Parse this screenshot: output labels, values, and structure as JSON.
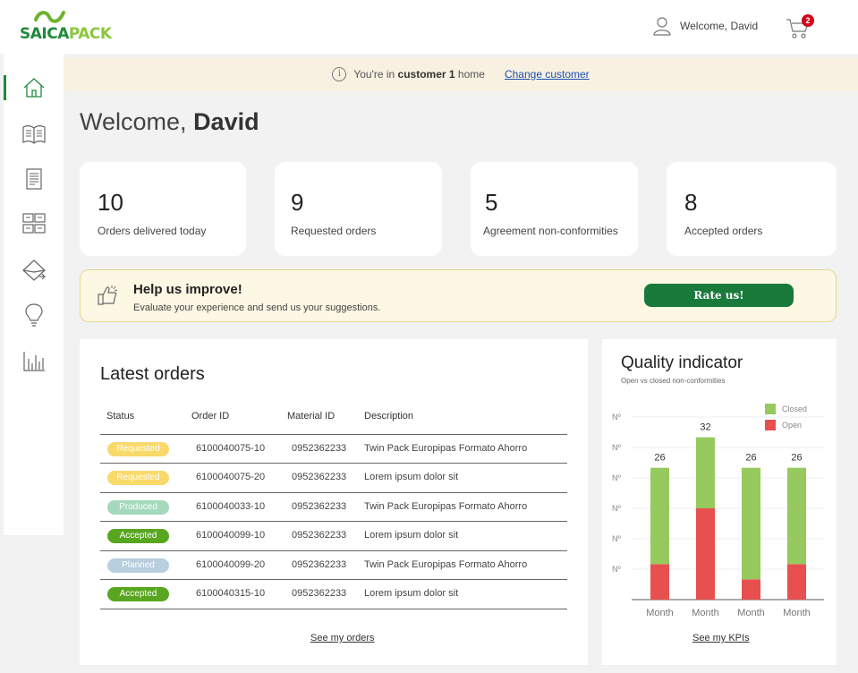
{
  "header": {
    "logo_text_a": "SAICA",
    "logo_text_b": "PACK",
    "welcome": "Welcome, David",
    "cart_count": "2"
  },
  "sidebar": {
    "items": [
      {
        "icon": "home-icon",
        "active": true
      },
      {
        "icon": "catalog-book-icon"
      },
      {
        "icon": "document-icon"
      },
      {
        "icon": "boxes-icon"
      },
      {
        "icon": "mail-icon"
      },
      {
        "icon": "lightbulb-icon"
      },
      {
        "icon": "bar-chart-icon"
      }
    ]
  },
  "banner": {
    "prefix": "You're in",
    "customer": "customer 1",
    "suffix": "home",
    "link": "Change customer"
  },
  "page": {
    "greeting": "Welcome,",
    "name": "David"
  },
  "kpis": [
    {
      "value": "10",
      "label": "Orders delivered today"
    },
    {
      "value": "9",
      "label": "Requested orders"
    },
    {
      "value": "5",
      "label": "Agreement non-conformities"
    },
    {
      "value": "8",
      "label": "Accepted orders"
    }
  ],
  "help": {
    "title": "Help us improve!",
    "subtitle": "Evaluate your experience and send us your suggestions.",
    "button": "Rate us!"
  },
  "orders": {
    "title": "Latest orders",
    "columns": [
      "Status",
      "Order ID",
      "Material ID",
      "Description"
    ],
    "rows": [
      {
        "status": "Requested",
        "order_id": "6100040075-10",
        "material_id": "0952362233",
        "description": "Twin Pack Europipas Formato Ahorro"
      },
      {
        "status": "Requested",
        "order_id": "6100040075-20",
        "material_id": "0952362233",
        "description": "Lorem ipsum dolor sit"
      },
      {
        "status": "Produced",
        "order_id": "6100040033-10",
        "material_id": "0952362233",
        "description": "Twin Pack Europipas Formato Ahorro"
      },
      {
        "status": "Accepted",
        "order_id": "6100040099-10",
        "material_id": "0952362233",
        "description": "Lorem ipsum dolor sit"
      },
      {
        "status": "Planned",
        "order_id": "6100040099-20",
        "material_id": "0952362233",
        "description": "Twin Pack Europipas Formato Ahorro"
      },
      {
        "status": "Accepted",
        "order_id": "6100040315-10",
        "material_id": "0952362233",
        "description": "Lorem ipsum dolor sit"
      }
    ],
    "status_colors": {
      "Requested": "#f8d96a",
      "Produced": "#a4d9bc",
      "Accepted": "#58a61f",
      "Planned": "#b7cfdf"
    },
    "link": "See my orders"
  },
  "quality": {
    "title": "Quality indicator",
    "subtitle": "Open vs closed non-conformities",
    "link": "See my KPIs"
  },
  "chart_data": {
    "type": "bar",
    "stacked": true,
    "categories": [
      "Month",
      "Month",
      "Month",
      "Month"
    ],
    "series": [
      {
        "name": "Open",
        "color": "#e85050",
        "values": [
          7,
          18,
          4,
          7
        ]
      },
      {
        "name": "Closed",
        "color": "#96c95e",
        "values": [
          19,
          14,
          22,
          19
        ]
      }
    ],
    "totals": [
      26,
      32,
      26,
      26
    ],
    "ytick_labels": [
      "Nº",
      "Nº",
      "Nº",
      "Nº",
      "Nº",
      "Nº"
    ],
    "ylim": [
      0,
      36
    ],
    "legend": "top-right",
    "grid": true
  }
}
